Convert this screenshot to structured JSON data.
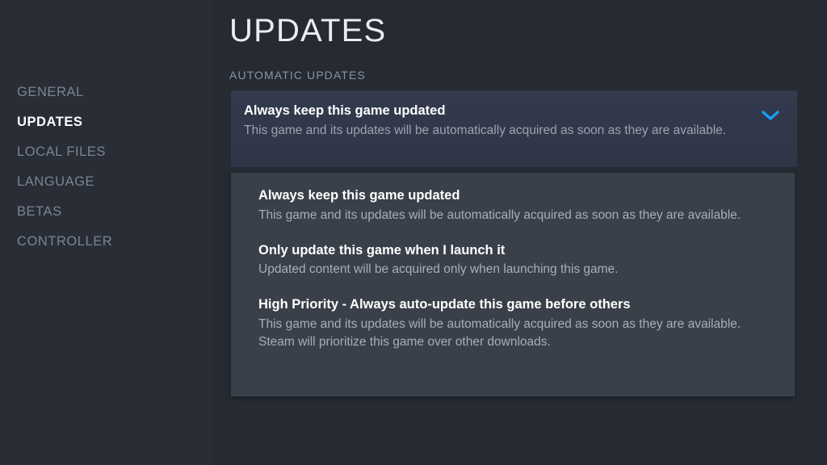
{
  "sidebar": {
    "items": [
      {
        "label": "GENERAL",
        "active": false
      },
      {
        "label": "UPDATES",
        "active": true
      },
      {
        "label": "LOCAL FILES",
        "active": false
      },
      {
        "label": "LANGUAGE",
        "active": false
      },
      {
        "label": "BETAS",
        "active": false
      },
      {
        "label": "CONTROLLER",
        "active": false
      }
    ]
  },
  "header": {
    "title": "UPDATES",
    "section_label": "AUTOMATIC UPDATES"
  },
  "dropdown": {
    "icon": "chevron-down-icon",
    "accent_color": "#1a9fff",
    "expanded": true,
    "selected": {
      "title": "Always keep this game updated",
      "description": "This game and its updates will be automatically acquired as soon as they are available."
    },
    "options": [
      {
        "title": "Always keep this game updated",
        "description": "This game and its updates will be automatically acquired as soon as they are available."
      },
      {
        "title": "Only update this game when I launch it",
        "description": "Updated content will be acquired only when launching this game."
      },
      {
        "title": "High Priority - Always auto-update this game before others",
        "description": "This game and its updates will be automatically acquired as soon as they are available. Steam will prioritize this game over other downloads."
      }
    ]
  }
}
